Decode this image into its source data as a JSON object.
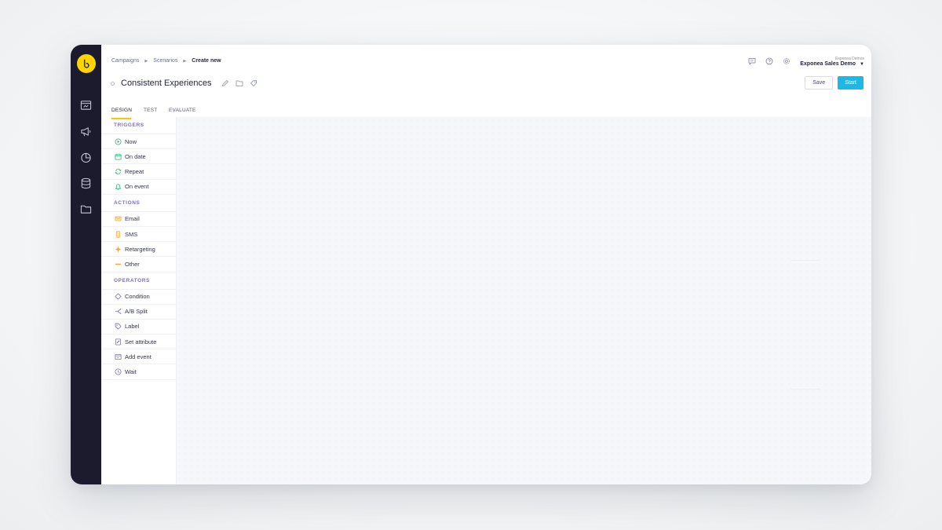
{
  "breadcrumb": {
    "items": [
      "Campaigns",
      "Scenarios"
    ],
    "current": "Create new"
  },
  "title": "Consistent Experiences",
  "account": {
    "organization": "Exponea Demos",
    "project": "Exponea Sales Demo"
  },
  "buttons": {
    "save": "Save",
    "start": "Start"
  },
  "tabs": [
    {
      "label": "DESIGN",
      "active": true
    },
    {
      "label": "TEST",
      "active": false
    },
    {
      "label": "EVALUATE",
      "active": false
    }
  ],
  "palette": {
    "triggers": {
      "title": "TRIGGERS",
      "items": [
        "Now",
        "On date",
        "Repeat",
        "On event"
      ]
    },
    "actions": {
      "title": "ACTIONS",
      "items": [
        "Email",
        "SMS",
        "Retargeting",
        "Other"
      ]
    },
    "operators": {
      "title": "OPERATORS",
      "items": [
        "Condition",
        "A/B Split",
        "Label",
        "Set attribute",
        "Add event",
        "Wait"
      ]
    }
  },
  "colors": {
    "rail": "#1c1b2e",
    "brand": "#ffd500",
    "accent": "#1fb8e6",
    "trigger": "#2bb673",
    "action": "#f2a93b",
    "operator": "#7b6fc8"
  }
}
